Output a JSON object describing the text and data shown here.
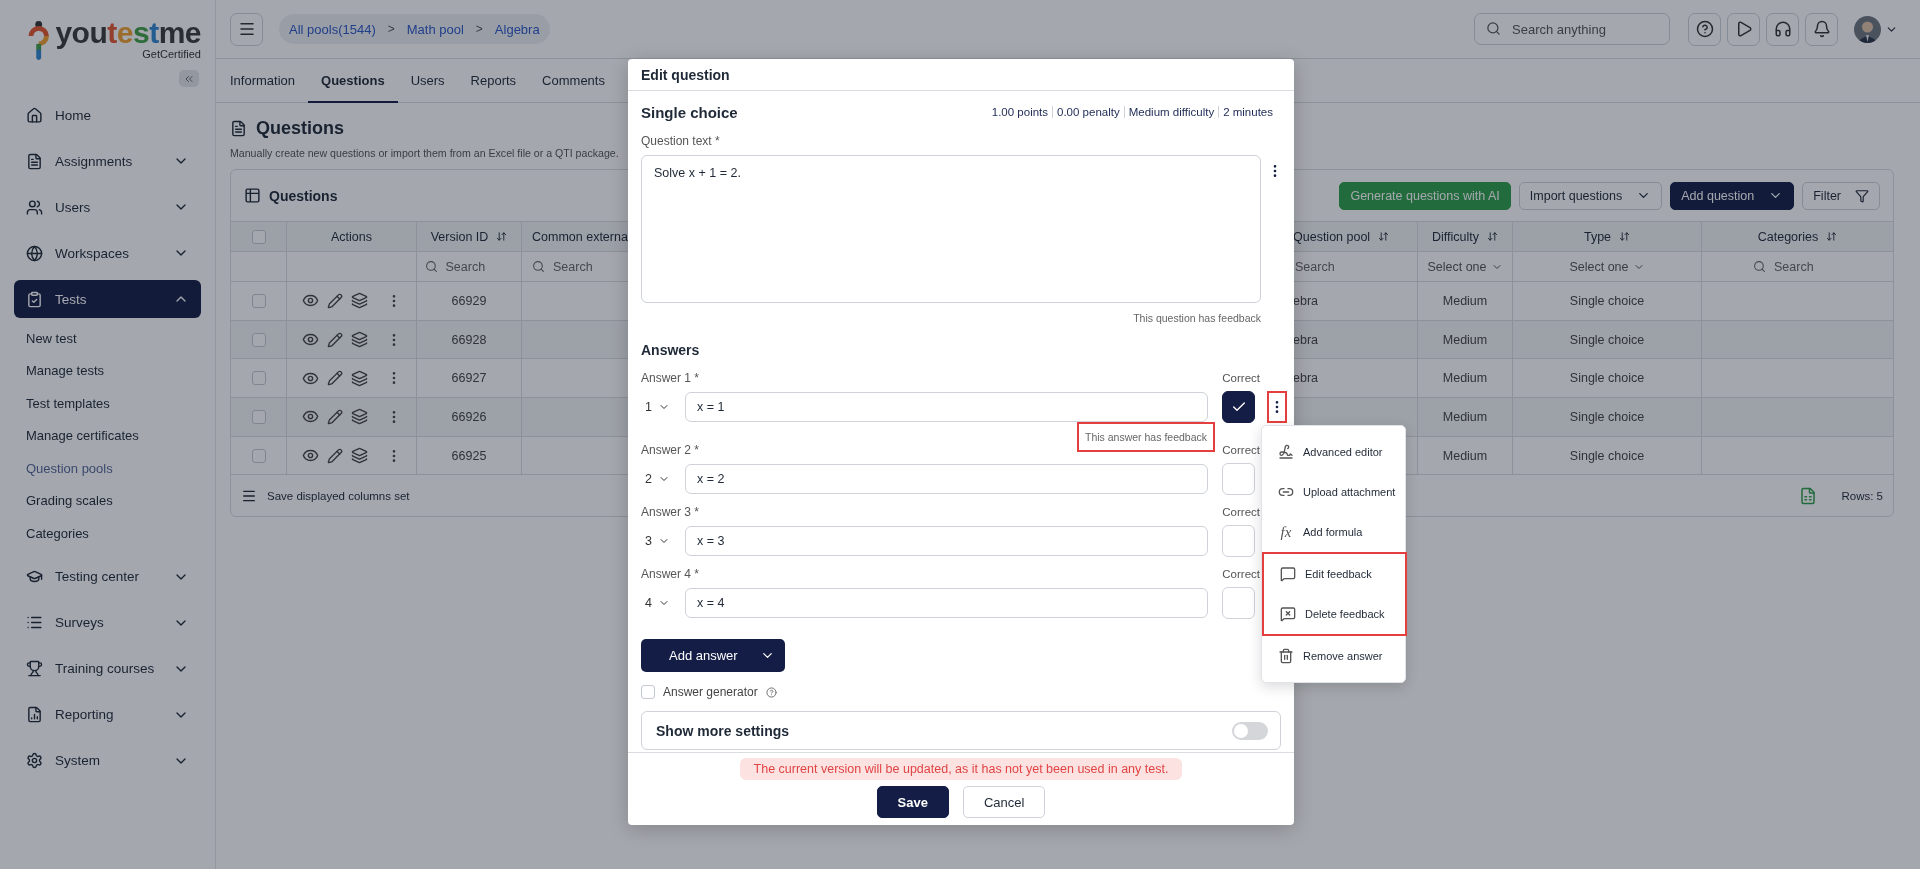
{
  "sidebar": {
    "logo": "youtestme",
    "tagline": "GetCertified",
    "items": [
      {
        "label": "Home",
        "kind": "link",
        "selected": false
      },
      {
        "label": "Assignments",
        "kind": "group",
        "expanded": false,
        "selected": false
      },
      {
        "label": "Users",
        "kind": "group",
        "expanded": false,
        "selected": false
      },
      {
        "label": "Workspaces",
        "kind": "group",
        "expanded": false,
        "selected": false
      },
      {
        "label": "Tests",
        "kind": "group",
        "expanded": true,
        "selected": true,
        "children": [
          {
            "label": "New test",
            "selected": false
          },
          {
            "label": "Manage tests",
            "selected": false
          },
          {
            "label": "Test templates",
            "selected": false
          },
          {
            "label": "Manage certificates",
            "selected": false
          },
          {
            "label": "Question pools",
            "selected": true
          },
          {
            "label": "Grading scales",
            "selected": false
          },
          {
            "label": "Categories",
            "selected": false
          }
        ]
      },
      {
        "label": "Testing center",
        "kind": "group",
        "expanded": false,
        "selected": false
      },
      {
        "label": "Surveys",
        "kind": "group",
        "expanded": false,
        "selected": false
      },
      {
        "label": "Training courses",
        "kind": "group",
        "expanded": false,
        "selected": false
      },
      {
        "label": "Reporting",
        "kind": "group",
        "expanded": false,
        "selected": false
      },
      {
        "label": "System",
        "kind": "group",
        "expanded": false,
        "selected": false
      }
    ]
  },
  "topbar": {
    "breadcrumb": [
      {
        "kind": "link",
        "text": "All pools(1544)"
      },
      {
        "kind": "separator",
        "text": ">"
      },
      {
        "kind": "link",
        "text": "Math pool"
      },
      {
        "kind": "separator",
        "text": ">"
      },
      {
        "kind": "link",
        "text": "Algebra"
      }
    ],
    "search": {
      "placeholder": "Search anything"
    }
  },
  "tabs": [
    {
      "label": "Information",
      "selected": false
    },
    {
      "label": "Questions",
      "selected": true
    },
    {
      "label": "Users",
      "selected": false
    },
    {
      "label": "Reports",
      "selected": false
    },
    {
      "label": "Comments",
      "selected": false
    }
  ],
  "page": {
    "title": "Questions",
    "description": "Manually create new questions or import them from an Excel file or a QTI package."
  },
  "table": {
    "title": "Questions",
    "actions": [
      {
        "label": "Generate questions with AI",
        "kind": "ai"
      },
      {
        "label": "Import questions",
        "kind": "dropdown"
      },
      {
        "label": "Add question",
        "kind": "primary"
      },
      {
        "label": "Filter",
        "kind": "filter"
      }
    ],
    "select_all": {
      "checked": false
    },
    "columns": [
      {
        "label": "Actions",
        "sortable": false
      },
      {
        "label": "Version ID",
        "sortable": true,
        "filter": {
          "kind": "search",
          "placeholder": "Search",
          "show_icon": true
        }
      },
      {
        "label": "Common externa",
        "sortable": false,
        "filter": {
          "kind": "search",
          "placeholder": "Search",
          "show_icon": true
        }
      },
      {
        "label": "Question pool",
        "sortable": true,
        "filter": {
          "kind": "search",
          "placeholder": "Search",
          "show_icon": false
        }
      },
      {
        "label": "Difficulty",
        "sortable": true,
        "filter": {
          "kind": "select",
          "placeholder": "Select one"
        }
      },
      {
        "label": "Type",
        "sortable": true,
        "filter": {
          "kind": "select",
          "placeholder": "Select one"
        }
      },
      {
        "label": "Categories",
        "sortable": true,
        "filter": {
          "kind": "search",
          "placeholder": "Search",
          "show_icon": true
        }
      }
    ],
    "rows": [
      {
        "selected": false,
        "version_id": "66929",
        "question_pool": "ebra",
        "difficulty": "Medium",
        "type": "Single choice"
      },
      {
        "selected": false,
        "version_id": "66928",
        "question_pool": "ebra",
        "difficulty": "Medium",
        "type": "Single choice"
      },
      {
        "selected": false,
        "version_id": "66927",
        "question_pool": "ebra",
        "difficulty": "Medium",
        "type": "Single choice"
      },
      {
        "selected": false,
        "version_id": "66926",
        "difficulty": "Medium",
        "type": "Single choice"
      },
      {
        "selected": false,
        "version_id": "66925",
        "difficulty": "Medium",
        "type": "Single choice"
      }
    ],
    "footer": {
      "save_columns": "Save displayed columns set",
      "rows": "Rows: 5"
    }
  },
  "dialog": {
    "title": "Edit question",
    "question_type": "Single choice",
    "meta": [
      "1.00 points",
      "0.00 penalty",
      "Medium difficulty",
      "2 minutes"
    ],
    "question_label": "Question text *",
    "question_text": "Solve x + 1 = 2.",
    "question_note": "This question has feedback",
    "answers_title": "Answers",
    "answers": [
      {
        "label": "Answer 1 *",
        "order": "1",
        "value": "x = 1",
        "correct_label": "Correct",
        "correct": true,
        "note": {
          "text": "This answer has feedback",
          "highlighted": true
        },
        "menu": {
          "highlighted": true,
          "items": [
            {
              "label": "Advanced editor",
              "highlighted": false
            },
            {
              "label": "Upload attachment",
              "highlighted": false
            },
            {
              "label": "Add formula",
              "glyph": "fx",
              "highlighted": false
            },
            {
              "label": "Edit feedback",
              "highlighted": true
            },
            {
              "label": "Delete feedback",
              "highlighted": true
            },
            {
              "label": "Remove answer",
              "highlighted": false
            }
          ]
        }
      },
      {
        "label": "Answer 2 *",
        "order": "2",
        "value": "x = 2",
        "correct_label": "Correct",
        "correct": false
      },
      {
        "label": "Answer 3 *",
        "order": "3",
        "value": "x = 3",
        "correct_label": "Correct",
        "correct": false
      },
      {
        "label": "Answer 4 *",
        "order": "4",
        "value": "x = 4",
        "correct_label": "Correct",
        "correct": false
      }
    ],
    "add_answer": "Add answer",
    "generator": {
      "label": "Answer generator",
      "checked": false
    },
    "more_settings": {
      "label": "Show more settings",
      "on": false
    },
    "warning": "The current version will be updated, as it has not yet been used in any test.",
    "buttons": [
      {
        "label": "Save",
        "kind": "primary"
      },
      {
        "label": "Cancel",
        "kind": "secondary"
      }
    ]
  }
}
